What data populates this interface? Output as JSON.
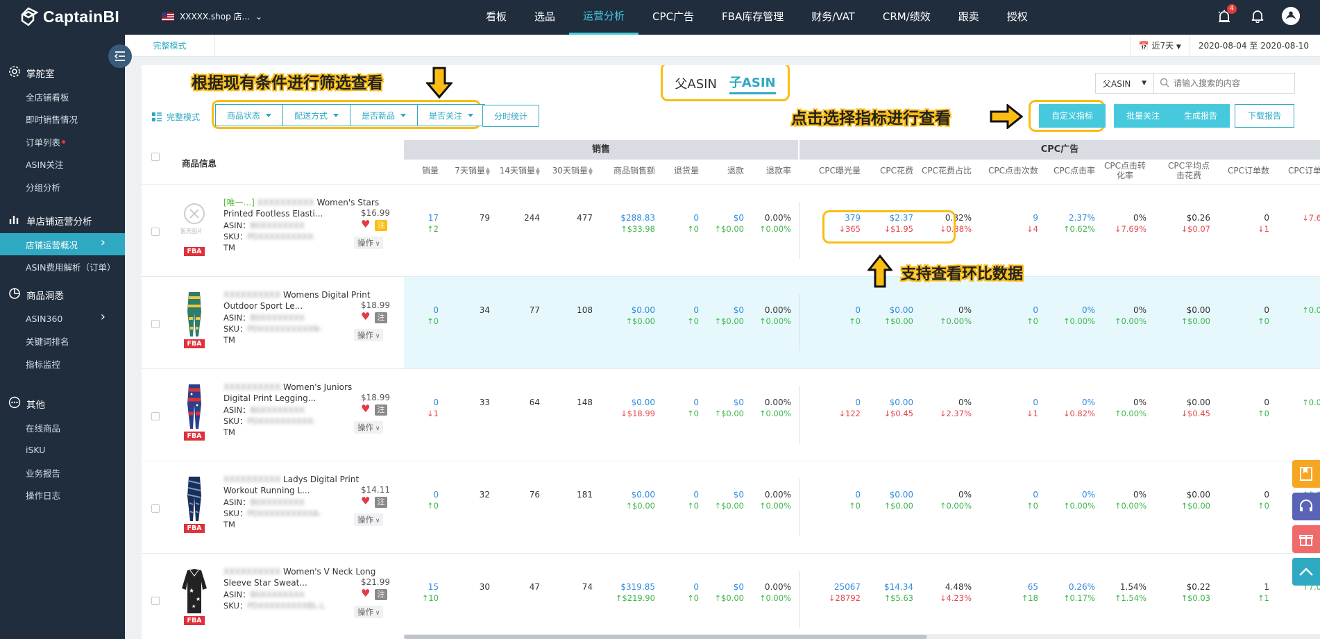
{
  "app": {
    "name": "CaptainBI",
    "shop_name": "XXXXX.shop 店...",
    "notification_count": "4"
  },
  "nav": {
    "items": [
      "看板",
      "选品",
      "运营分析",
      "CPC广告",
      "FBA库存管理",
      "财务/VAT",
      "CRM/绩效",
      "跟卖",
      "授权"
    ],
    "active_index": 2
  },
  "sidebar": {
    "sections": [
      {
        "label": "掌舵室",
        "icon": "dashboard-gear-icon",
        "items": [
          "全店铺看板",
          "即时销售情况",
          "订单列表",
          "ASIN关注",
          "分组分析"
        ]
      },
      {
        "label": "单店铺运营分析",
        "icon": "bar-chart-icon",
        "items": [
          "店铺运营概况",
          "ASIN费用解析（订单）"
        ]
      },
      {
        "label": "商品洞悉",
        "icon": "pie-chart-icon",
        "items": [
          "ASIN360",
          "关键词排名",
          "指标监控"
        ]
      },
      {
        "label": "其他",
        "icon": "more-dots-icon",
        "items": [
          "在线商品",
          "iSKU",
          "业务报告",
          "操作日志"
        ]
      }
    ],
    "active_item": "店铺运营概况"
  },
  "subbar": {
    "mode_tab": "完整模式",
    "date_preset": "近7天",
    "date_start": "2020-08-04",
    "date_to": "至",
    "date_end": "2020-08-10"
  },
  "toggle": {
    "parent": "父ASIN",
    "child": "子ASIN",
    "active": "child"
  },
  "search": {
    "select_value": "父ASIN",
    "placeholder": "请输入搜索的内容"
  },
  "filters": {
    "mode_label": "完整模式",
    "items": [
      "商品状态",
      "配送方式",
      "是否新品",
      "是否关注"
    ],
    "extra": "分时统计"
  },
  "actions": {
    "custom": "自定义指标",
    "batch": "批量关注",
    "report": "生成报告",
    "download": "下载报告"
  },
  "callouts": {
    "filter": "根据现有条件进行筛选查看",
    "metric": "点击选择指标进行查看",
    "compare": "支持查看环比数据"
  },
  "table": {
    "product_header": "商品信息",
    "group_sales": "销售",
    "group_cpc": "CPC广告",
    "columns": [
      {
        "label": "销量",
        "sort": false
      },
      {
        "label": "7天销量",
        "sort": true
      },
      {
        "label": "14天销量",
        "sort": true
      },
      {
        "label": "30天销量",
        "sort": true
      },
      {
        "label": "商品销售额",
        "sort": false
      },
      {
        "label": "退货量",
        "sort": false
      },
      {
        "label": "退款",
        "sort": false
      },
      {
        "label": "退款率",
        "sort": false
      },
      {
        "label": "CPC曝光量",
        "sort": false
      },
      {
        "label": "CPC花费",
        "sort": false
      },
      {
        "label": "CPC花费占比",
        "sort": false
      },
      {
        "label": "CPC点击次数",
        "sort": false
      },
      {
        "label": "CPC点击率",
        "sort": false
      },
      {
        "label": "CPC点击转化率",
        "sort": false
      },
      {
        "label": "CPC平均点击花费",
        "sort": false
      },
      {
        "label": "CPC订单数",
        "sort": false
      },
      {
        "label": "CPC订单",
        "sort": false
      }
    ],
    "asin_label": "ASIN：",
    "sku_label": "SKU：",
    "op_label": "操作",
    "fba_label": "FBA",
    "follow_label": "注",
    "rows": [
      {
        "tag": "[唯一...]",
        "title1": "Women's Stars",
        "title2": "Printed Footless Elasti...",
        "price": "$16.99",
        "asin": "B0XXXXXXXX",
        "sku": "PDXXXXXXXXXX-",
        "sku2": "TM",
        "no_image": "暂无图片",
        "followed": true,
        "cells": [
          [
            "17",
            "↑2"
          ],
          [
            "79",
            ""
          ],
          [
            "244",
            ""
          ],
          [
            "477",
            ""
          ],
          [
            "$288.83",
            "↑$33.98"
          ],
          [
            "0",
            "↑0"
          ],
          [
            "$0",
            "↑$0.00"
          ],
          [
            "0.00%",
            "↑0.00%"
          ],
          [
            "379",
            "↓365"
          ],
          [
            "$2.37",
            "↓$1.95"
          ],
          [
            "0.82%",
            "↓0.88%"
          ],
          [
            "9",
            "↓4"
          ],
          [
            "2.37%",
            "↑0.62%"
          ],
          [
            "0%",
            "↓7.69%"
          ],
          [
            "$0.26",
            "↓$0.07"
          ],
          [
            "0",
            "↓1"
          ],
          [
            "",
            "↓7.6"
          ]
        ]
      },
      {
        "tag": "",
        "title1": "Womens Digital Print",
        "title2": "Outdoor Sport Le...",
        "price": "$18.99",
        "asin": "B0XXXXXXXX",
        "sku": "PDXXXXXXXXXXN-",
        "sku2": "TM",
        "followed": false,
        "cells": [
          [
            "0",
            "↑0"
          ],
          [
            "34",
            ""
          ],
          [
            "77",
            ""
          ],
          [
            "108",
            ""
          ],
          [
            "$0.00",
            "↑$0.00"
          ],
          [
            "0",
            "↑0"
          ],
          [
            "$0",
            "↑$0.00"
          ],
          [
            "0.00%",
            "↑0.00%"
          ],
          [
            "0",
            "↑0"
          ],
          [
            "$0.00",
            "↑$0.00"
          ],
          [
            "0%",
            "↑0.00%"
          ],
          [
            "0",
            "↑0"
          ],
          [
            "0%",
            "↑0.00%"
          ],
          [
            "0%",
            "↑0.00%"
          ],
          [
            "$0.00",
            "↑$0.00"
          ],
          [
            "0",
            "↑0"
          ],
          [
            "",
            "↑0.0"
          ]
        ]
      },
      {
        "tag": "",
        "title1": "Women's Juniors",
        "title2": "Digital Print Legging...",
        "price": "$18.99",
        "asin": "B0XXXXXXXX",
        "sku": "PDXXXXXXXXXX-",
        "sku2": "TM",
        "followed": false,
        "cells": [
          [
            "0",
            "↓1"
          ],
          [
            "33",
            ""
          ],
          [
            "64",
            ""
          ],
          [
            "148",
            ""
          ],
          [
            "$0.00",
            "↓$18.99"
          ],
          [
            "0",
            "↑0"
          ],
          [
            "$0",
            "↑$0.00"
          ],
          [
            "0.00%",
            "↑0.00%"
          ],
          [
            "0",
            "↓122"
          ],
          [
            "$0.00",
            "↓$0.45"
          ],
          [
            "0%",
            "↓2.37%"
          ],
          [
            "0",
            "↓1"
          ],
          [
            "0%",
            "↓0.82%"
          ],
          [
            "0%",
            "↑0.00%"
          ],
          [
            "$0.00",
            "↓$0.45"
          ],
          [
            "0",
            "↑0"
          ],
          [
            "",
            "↑0.0"
          ]
        ]
      },
      {
        "tag": "",
        "title1": "Ladys Digital Print",
        "title2": "Workout Running L...",
        "price": "$14.11",
        "asin": "B0XXXXXXXX",
        "sku": "PDXXXXXXXXXXA-",
        "sku2": "TM",
        "followed": false,
        "cells": [
          [
            "0",
            "↑0"
          ],
          [
            "32",
            ""
          ],
          [
            "76",
            ""
          ],
          [
            "181",
            ""
          ],
          [
            "$0.00",
            "↑$0.00"
          ],
          [
            "0",
            "↑0"
          ],
          [
            "$0",
            "↑$0.00"
          ],
          [
            "0.00%",
            "↑0.00%"
          ],
          [
            "0",
            "↑0"
          ],
          [
            "$0.00",
            "↑$0.00"
          ],
          [
            "0%",
            "↑0.00%"
          ],
          [
            "0",
            "↑0"
          ],
          [
            "0%",
            "↑0.00%"
          ],
          [
            "0%",
            "↑0.00%"
          ],
          [
            "$0.00",
            "↑$0.00"
          ],
          [
            "0",
            "↑0"
          ],
          [
            "",
            "↑0.0"
          ]
        ]
      },
      {
        "tag": "",
        "title1": "Women's V Neck Long",
        "title2": "Sleeve Star Sweat...",
        "price": "$21.99",
        "asin": "B0XXXXXXXX",
        "sku": "PDXXXXXXXXXBL-L",
        "sku2": "",
        "followed": false,
        "cells": [
          [
            "15",
            "↑10"
          ],
          [
            "30",
            ""
          ],
          [
            "47",
            ""
          ],
          [
            "74",
            ""
          ],
          [
            "$319.85",
            "↑$219.90"
          ],
          [
            "0",
            "↑0"
          ],
          [
            "$0",
            "↑$0.00"
          ],
          [
            "0.00%",
            "↑0.00%"
          ],
          [
            "25067",
            "↓28792"
          ],
          [
            "$14.34",
            "↑$5.63"
          ],
          [
            "4.48%",
            "↓4.23%"
          ],
          [
            "65",
            "↑18"
          ],
          [
            "0.26%",
            "↑0.17%"
          ],
          [
            "1.54%",
            "↑1.54%"
          ],
          [
            "$0.22",
            "↑$0.03"
          ],
          [
            "1",
            "↑1"
          ],
          [
            "",
            "↑7.0"
          ]
        ]
      }
    ]
  },
  "colors": {
    "accent": "#2fa9c2",
    "up": "#3cb64a",
    "down": "#e6464e",
    "highlight": "#fbbd14",
    "topbar": "#1f2d3d"
  }
}
